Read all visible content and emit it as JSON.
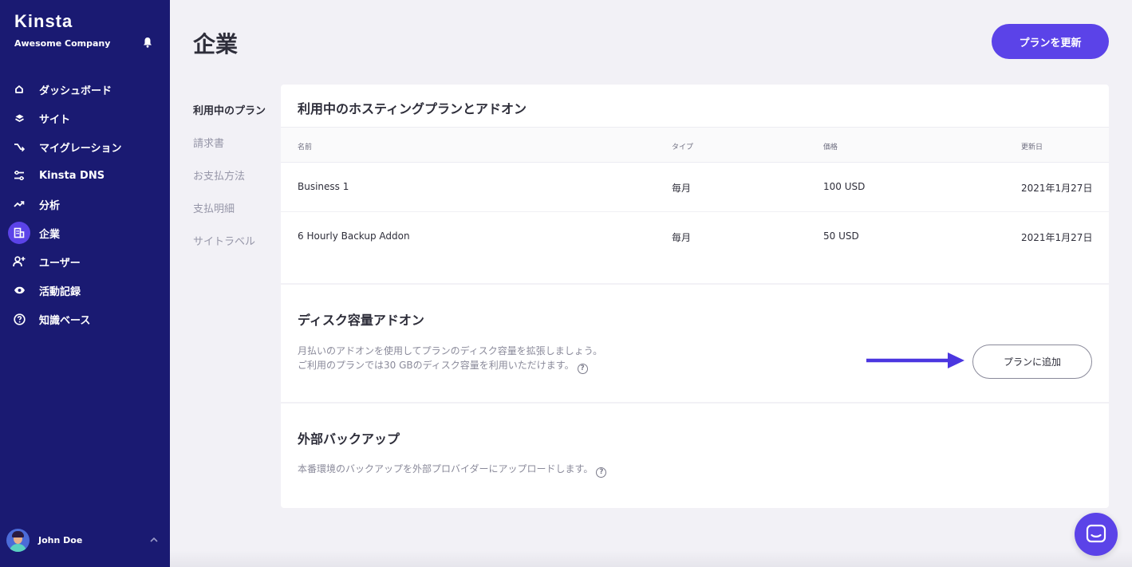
{
  "brand": {
    "logo": "Kinsta",
    "company": "Awesome Company",
    "accent": "#5b43e8",
    "sidebar_bg": "#1a1a72"
  },
  "sidebar": {
    "items": [
      {
        "label": "ダッシュボード",
        "icon": "home-icon"
      },
      {
        "label": "サイト",
        "icon": "layers-icon"
      },
      {
        "label": "マイグレーション",
        "icon": "migration-icon"
      },
      {
        "label": "Kinsta DNS",
        "icon": "dns-icon"
      },
      {
        "label": "分析",
        "icon": "trend-icon"
      },
      {
        "label": "企業",
        "icon": "company-icon",
        "active": true
      },
      {
        "label": "ユーザー",
        "icon": "add-user-icon"
      },
      {
        "label": "活動記録",
        "icon": "eye-icon"
      },
      {
        "label": "知識ベース",
        "icon": "help-circle-icon"
      }
    ],
    "user": {
      "name": "John Doe"
    }
  },
  "header": {
    "title": "企業",
    "primary_button": "プランを更新"
  },
  "subnav": {
    "items": [
      "利用中のプラン",
      "請求書",
      "お支払方法",
      "支払明細",
      "サイトラベル"
    ],
    "active_index": 0
  },
  "plans": {
    "title": "利用中のホスティングプランとアドオン",
    "columns": [
      "名前",
      "タイプ",
      "価格",
      "更新日"
    ],
    "rows": [
      [
        "Business 1",
        "毎月",
        "100 USD",
        "2021年1月27日"
      ],
      [
        "6 Hourly Backup Addon",
        "毎月",
        "50 USD",
        "2021年1月27日"
      ]
    ]
  },
  "disk_addon": {
    "title": "ディスク容量アドオン",
    "desc_line1": "月払いのアドオンを使用してプランのディスク容量を拡張しましょう。",
    "desc_line2": "ご利用のプランでは30 GBのディスク容量を利用いただけます。",
    "button": "プランに追加"
  },
  "external_backup": {
    "title": "外部バックアップ",
    "desc": "本番環境のバックアップを外部プロバイダーにアップロードします。"
  }
}
